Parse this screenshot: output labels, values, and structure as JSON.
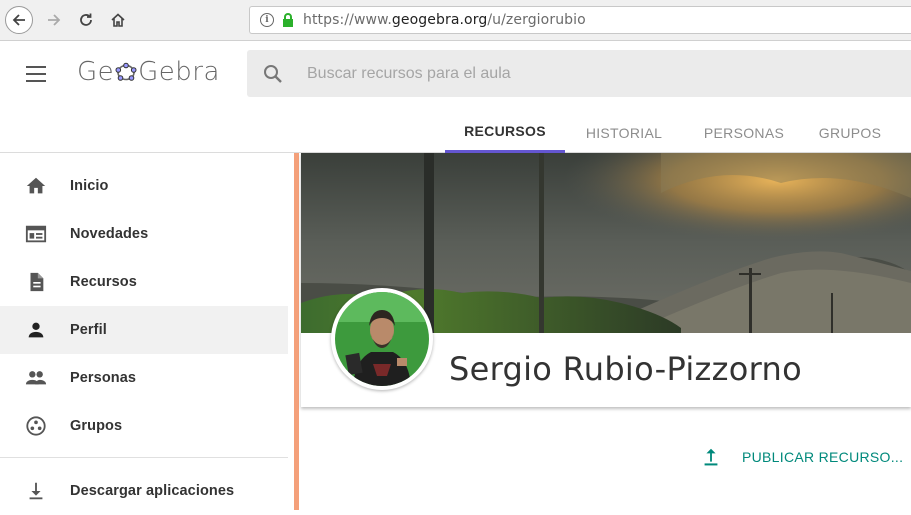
{
  "browser": {
    "url_prefix": "https://www.",
    "url_domain": "geogebra.org",
    "url_path": "/u/zergiorubio"
  },
  "header": {
    "logo_left": "Ge",
    "logo_right": "Gebra",
    "search_placeholder": "Buscar recursos para el aula",
    "tabs": [
      {
        "label": "RECURSOS",
        "active": true
      },
      {
        "label": "HISTORIAL",
        "active": false
      },
      {
        "label": "PERSONAS",
        "active": false
      },
      {
        "label": "GRUPOS",
        "active": false
      }
    ]
  },
  "sidebar": {
    "items": [
      {
        "label": "Inicio",
        "icon": "home-icon"
      },
      {
        "label": "Novedades",
        "icon": "newsfeed-icon"
      },
      {
        "label": "Recursos",
        "icon": "document-icon"
      },
      {
        "label": "Perfil",
        "icon": "person-icon",
        "active": true
      },
      {
        "label": "Personas",
        "icon": "people-icon"
      },
      {
        "label": "Grupos",
        "icon": "groups-icon"
      }
    ],
    "download": {
      "label": "Descargar aplicaciones",
      "icon": "download-icon"
    }
  },
  "profile": {
    "name": "Sergio Rubio-Pizzorno"
  },
  "actions": {
    "publish_label": "PUBLICAR RECURSO..."
  },
  "colors": {
    "accent": "#6557d2",
    "publish": "#00897b",
    "accent_strip": "#f4a07a",
    "lock": "#2bb02b"
  }
}
